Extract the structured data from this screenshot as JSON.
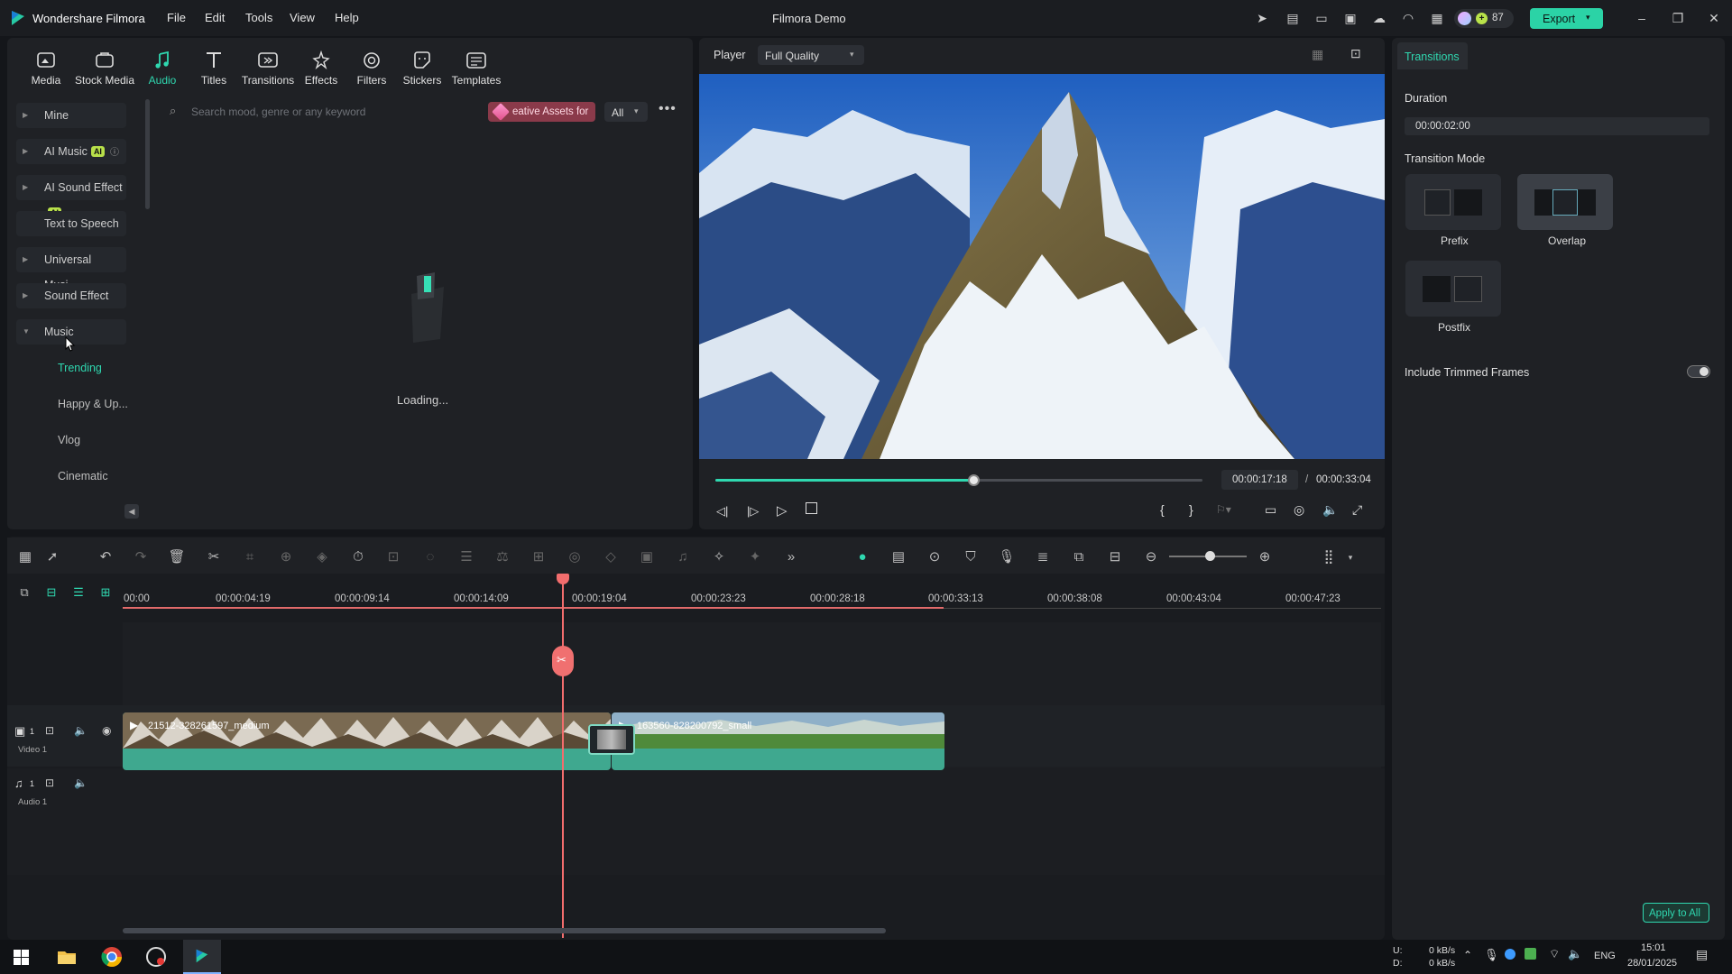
{
  "app": {
    "brand": "Wondershare Filmora",
    "title": "Filmora Demo",
    "menu": [
      "File",
      "Edit",
      "Tools",
      "View",
      "Help"
    ],
    "credits": "87",
    "export_label": "Export"
  },
  "media_tabs": [
    "Media",
    "Stock Media",
    "Audio",
    "Titles",
    "Transitions",
    "Effects",
    "Filters",
    "Stickers",
    "Templates"
  ],
  "audio_panel": {
    "categories": [
      "Mine",
      "AI Music",
      "AI Sound Effect",
      "Text to Speech",
      "Universal Musi...",
      "Sound Effect",
      "Music"
    ],
    "ai_badge": "AI",
    "subcategories": [
      "Trending",
      "Happy & Up...",
      "Vlog",
      "Cinematic"
    ],
    "search_placeholder": "Search mood, genre or any keyword",
    "assets_button": "eative Assets for",
    "filter": "All",
    "loading": "Loading..."
  },
  "player": {
    "label": "Player",
    "quality": "Full Quality",
    "current_time": "00:00:17:18",
    "separator": "/",
    "total_time": "00:00:33:04",
    "progress": 0.53
  },
  "inspector": {
    "tab": "Transitions",
    "duration_label": "Duration",
    "duration_value": "00:00:02:00",
    "mode_label": "Transition Mode",
    "modes": [
      "Prefix",
      "Overlap",
      "Postfix"
    ],
    "selected_mode": "Overlap",
    "include_trimmed": "Include Trimmed Frames",
    "include_trimmed_on": false,
    "apply_all": "Apply to All"
  },
  "timeline": {
    "ruler": [
      "00:00",
      "00:00:04:19",
      "00:00:09:14",
      "00:00:14:09",
      "00:00:19:04",
      "00:00:23:23",
      "00:00:28:18",
      "00:00:33:13",
      "00:00:38:08",
      "00:00:43:04",
      "00:00:47:23"
    ],
    "tracks": [
      {
        "label": "Video 1",
        "index": "1"
      },
      {
        "label": "Audio 1",
        "index": "1"
      }
    ],
    "clips": [
      "21512-328261597_medium",
      "163560-828200792_small"
    ]
  },
  "taskbar": {
    "net_up": "0 kB/s",
    "net_down": "0 kB/s",
    "drive_u": "U:",
    "drive_d": "D:",
    "lang": "ENG",
    "time": "15:01",
    "date": "28/01/2025"
  },
  "colors": {
    "accent": "#2fd8b0",
    "playhead": "#f26d6d",
    "clip": "#3fa88f",
    "export_bg": "#2bd3a6"
  }
}
